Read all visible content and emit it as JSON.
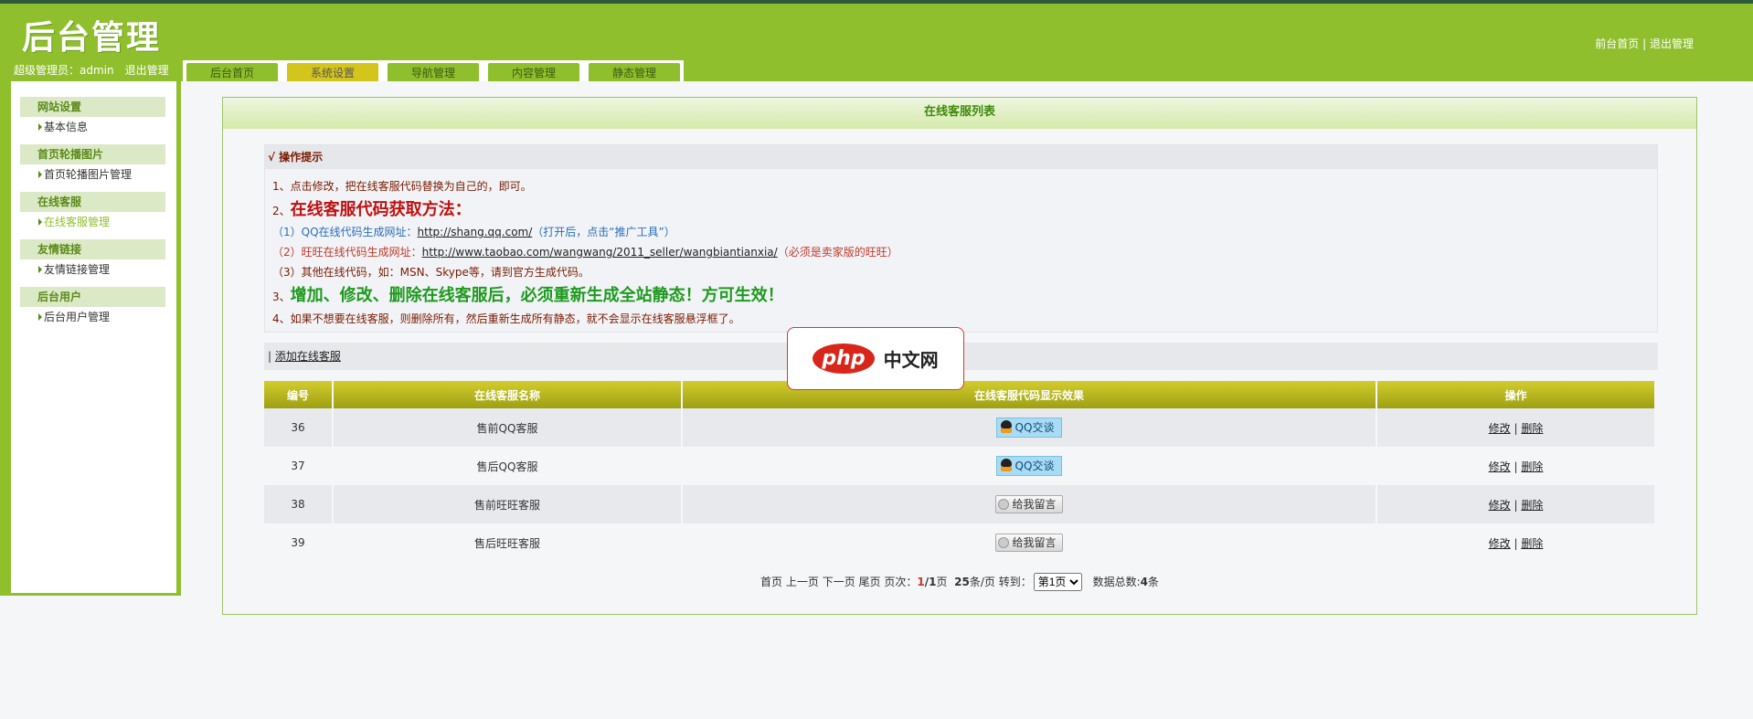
{
  "header": {
    "logo": "后台管理",
    "admin_label": "超级管理员：admin",
    "logout": "退出管理",
    "front_link": "前台首页",
    "sep": "|",
    "exit_link": "退出管理"
  },
  "tabs": [
    {
      "label": "后台首页"
    },
    {
      "label": "系统设置"
    },
    {
      "label": "导航管理"
    },
    {
      "label": "内容管理"
    },
    {
      "label": "静态管理"
    }
  ],
  "sidebar": [
    {
      "title": "网站设置",
      "item": "基本信息"
    },
    {
      "title": "首页轮播图片",
      "item": "首页轮播图片管理"
    },
    {
      "title": "在线客服",
      "item": "在线客服管理"
    },
    {
      "title": "友情链接",
      "item": "友情链接管理"
    },
    {
      "title": "后台用户",
      "item": "后台用户管理"
    }
  ],
  "panel": {
    "title": "在线客服列表"
  },
  "tips": {
    "heading": "√ 操作提示",
    "l1": "1、点击修改，把在线客服代码替换为自己的，即可。",
    "l2_num": "2、",
    "l2": "在线客服代码获取方法：",
    "l3_a": "（1）QQ在线代码生成网址：",
    "l3_link": "http://shang.qq.com/",
    "l3_b": "（打开后，点击“推广工具”）",
    "l4_a": "（2）旺旺在线代码生成网址：",
    "l4_link": "http://www.taobao.com/wangwang/2011_seller/wangbiantianxia/",
    "l4_b": "（必须是卖家版的旺旺）",
    "l5": "（3）其他在线代码，如：MSN、Skype等，请到官方生成代码。",
    "l6_num": "3、",
    "l6": "增加、修改、删除在线客服后，必须重新生成全站静态！方可生效！",
    "l7": "4、如果不想要在线客服，则删除所有，然后重新生成所有静态，就不会显示在线客服悬浮框了。"
  },
  "add_bar": {
    "sep": "|",
    "link": "添加在线客服"
  },
  "table": {
    "headers": [
      "编号",
      "在线客服名称",
      "在线客服代码显示效果",
      "操作"
    ],
    "rows": [
      {
        "id": "36",
        "name": "售前QQ客服",
        "btn": "QQ交谈",
        "type": "qq"
      },
      {
        "id": "37",
        "name": "售后QQ客服",
        "btn": "QQ交谈",
        "type": "qq"
      },
      {
        "id": "38",
        "name": "售前旺旺客服",
        "btn": "给我留言",
        "type": "ww"
      },
      {
        "id": "39",
        "name": "售后旺旺客服",
        "btn": "给我留言",
        "type": "ww"
      }
    ],
    "edit": "修改",
    "del": "删除",
    "sep": "|"
  },
  "pager": {
    "first": "首页",
    "prev": "上一页",
    "next": "下一页",
    "last": "尾页",
    "pages_label": "页次：",
    "current": "1",
    "total": "/1",
    "page_unit": "页",
    "per_page": "25",
    "per_page_unit": "条/页",
    "goto": "转到：",
    "select": "第1页",
    "total_label": "数据总数:",
    "total_count": "4",
    "total_unit": "条"
  },
  "watermark": {
    "php": "php",
    "cn": "中文网"
  }
}
